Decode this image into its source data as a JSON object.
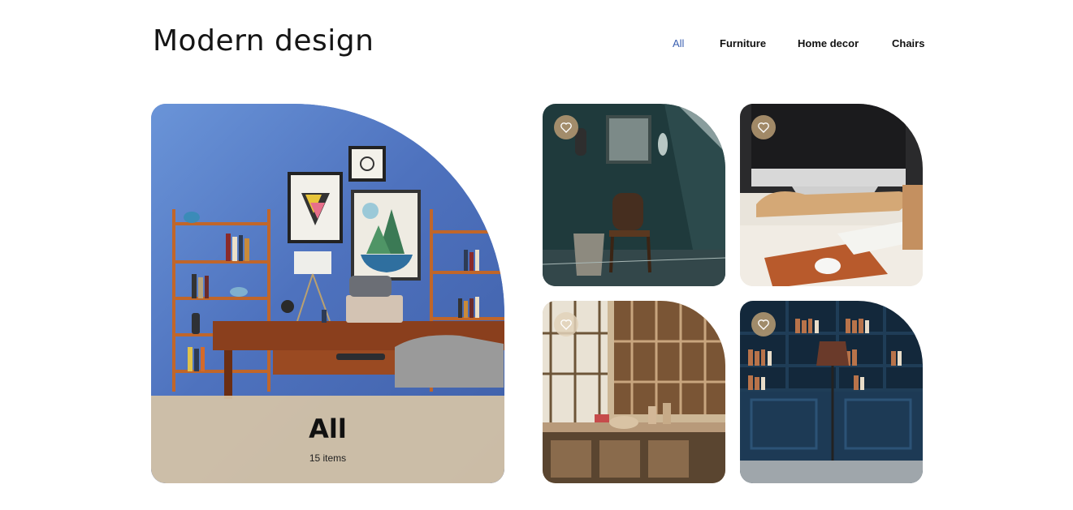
{
  "header": {
    "title": "Modern design"
  },
  "nav": {
    "items": [
      {
        "label": "All",
        "active": true
      },
      {
        "label": "Furniture",
        "active": false
      },
      {
        "label": "Home decor",
        "active": false
      },
      {
        "label": "Chairs",
        "active": false
      }
    ]
  },
  "feature": {
    "title": "All",
    "count": "15 items"
  },
  "colors": {
    "accent": "#3a5fb0",
    "caption_bg": "#d7c4a6",
    "heart_bg": "#b09670"
  },
  "cards": [
    {
      "icon": "heart-icon"
    },
    {
      "icon": "heart-icon"
    },
    {
      "icon": "heart-icon"
    },
    {
      "icon": "heart-icon"
    }
  ]
}
